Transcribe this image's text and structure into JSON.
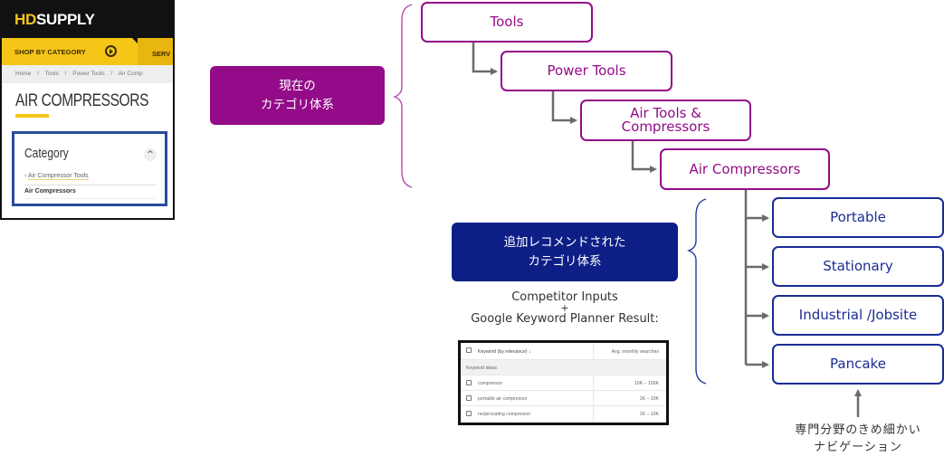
{
  "hd_supply_panel": {
    "logo_prefix": "HD",
    "logo_suffix": "SUPPLY",
    "nav": {
      "shop_by_category": "SHOP BY CATEGORY",
      "services": "SERV"
    },
    "breadcrumb": [
      "Home",
      "/",
      "Tools",
      "/",
      "Power Tools",
      "/",
      "Air Comp"
    ],
    "page_title": "AIR COMPRESSORS",
    "category_widget": {
      "title": "Category",
      "collapse_icon": "^",
      "back_icon": "‹",
      "back_link": "Air Compressor Tools",
      "current": "Air Compressors"
    }
  },
  "current_taxonomy": {
    "label_line1": "現在の",
    "label_line2": "カテゴリ体系",
    "color": "#930b88",
    "nodes": [
      {
        "label": "Tools"
      },
      {
        "label": "Power Tools"
      },
      {
        "label_line1": "Air Tools &",
        "label_line2": "Compressors"
      },
      {
        "label": "Air Compressors"
      }
    ]
  },
  "recommended_taxonomy": {
    "label_line1": "追加レコメンドされた",
    "label_line2": "カテゴリ体系",
    "color": "#0d1f86",
    "nodes": [
      {
        "label": "Portable"
      },
      {
        "label": "Stationary"
      },
      {
        "label": "Industrial /Jobsite"
      },
      {
        "label": "Pancake"
      }
    ]
  },
  "source_caption": {
    "line1": "Competitor Inputs",
    "plus": "+",
    "line2": "Google Keyword Planner Result:"
  },
  "keyword_table": {
    "header_keyword": "Keyword (by relevance)",
    "sort_icon": "↓",
    "header_searches": "Avg. monthly searches",
    "group_label": "Keyword ideas",
    "rows": [
      {
        "keyword": "compressor",
        "searches": "10K – 100K"
      },
      {
        "keyword": "portable air compressor",
        "searches": "1K – 10K"
      },
      {
        "keyword": "reciprocating compressor",
        "searches": "1K – 10K"
      }
    ]
  },
  "note": {
    "line1": "専門分野のきめ細かい",
    "line2": "ナビゲーション"
  }
}
